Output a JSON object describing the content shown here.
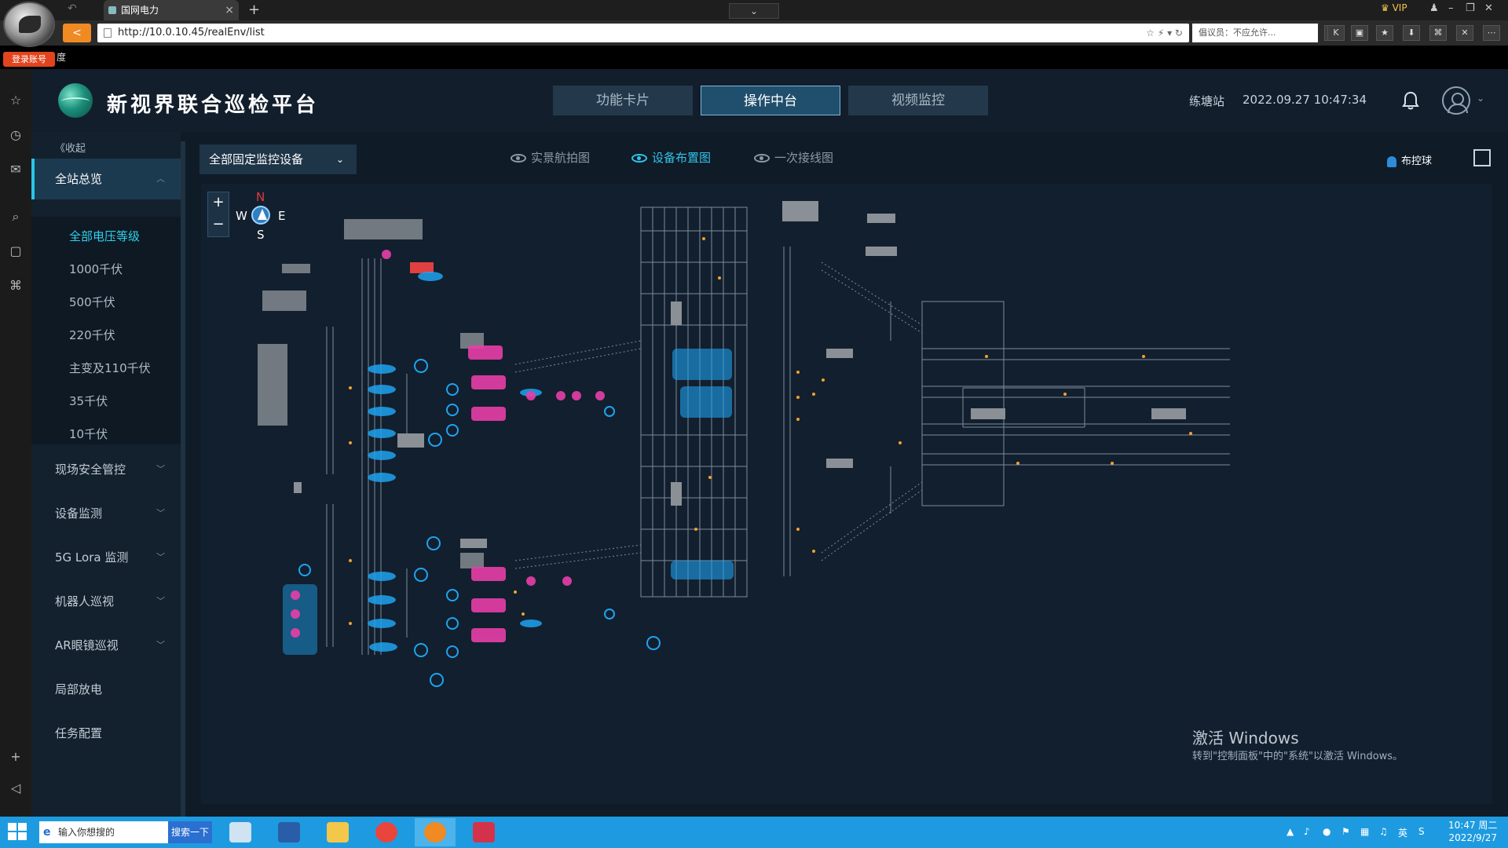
{
  "browser": {
    "tab_title": "国网电力",
    "tab_close": "×",
    "new_tab": "+",
    "tab_list": "⌄",
    "url": "http://10.0.10.45/realEnv/list",
    "search_placeholder": "倡议员：不应允许...",
    "login_badge": "登录账号",
    "bookmark_fragment": "度",
    "vip": "VIP"
  },
  "app": {
    "title": "新视界联合巡检平台",
    "top_tabs": [
      "功能卡片",
      "操作中台",
      "视频监控"
    ],
    "active_top_tab": "操作中台",
    "station": "练塘站",
    "datetime": "2022.09.27 10:47:34"
  },
  "sidebar": {
    "collapse": "《收起",
    "overview": "全站总览",
    "sub_items": [
      "全部电压等级",
      "1000千伏",
      "500千伏",
      "220千伏",
      "主变及110千伏",
      "35千伏",
      "10千伏"
    ],
    "groups": [
      "现场安全管控",
      "设备监测",
      "5G Lora 监测",
      "机器人巡视",
      "AR眼镜巡视",
      "局部放电",
      "任务配置"
    ]
  },
  "content": {
    "device_filter": "全部固定监控设备",
    "views": [
      "实景航拍图",
      "设备布置图",
      "一次接线图"
    ],
    "active_view": "设备布置图",
    "ball_button": "布控球",
    "compass": {
      "n": "N",
      "s": "S",
      "w": "W",
      "e": "E"
    },
    "zoom_in": "+",
    "zoom_out": "−",
    "watermark_title": "激活 Windows",
    "watermark_sub": "转到\"控制面板\"中的\"系统\"以激活 Windows。"
  },
  "taskbar": {
    "search_placeholder": "输入你想搜的",
    "search_button": "搜索一下",
    "ime": "英",
    "clock_time": "10:47 周二",
    "clock_date": "2022/9/27"
  },
  "colors": {
    "accent": "#30d0ee",
    "device_blue": "#1fa3f0",
    "device_pink": "#e83fa8",
    "device_orange": "#f0a22e"
  }
}
